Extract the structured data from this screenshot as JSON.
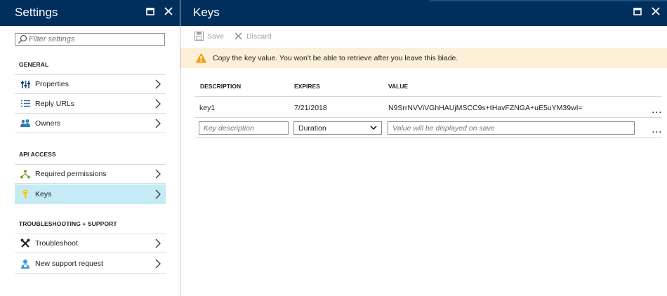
{
  "settings": {
    "title": "Settings",
    "filter_placeholder": "Filter settings",
    "sections": [
      {
        "title": "GENERAL",
        "items": [
          {
            "label": "Properties",
            "icon": "properties-icon"
          },
          {
            "label": "Reply URLs",
            "icon": "list-icon"
          },
          {
            "label": "Owners",
            "icon": "owners-icon"
          }
        ]
      },
      {
        "title": "API ACCESS",
        "items": [
          {
            "label": "Required permissions",
            "icon": "permissions-icon"
          },
          {
            "label": "Keys",
            "icon": "key-icon",
            "selected": true
          }
        ]
      },
      {
        "title": "TROUBLESHOOTING + SUPPORT",
        "items": [
          {
            "label": "Troubleshoot",
            "icon": "troubleshoot-icon"
          },
          {
            "label": "New support request",
            "icon": "support-icon"
          }
        ]
      }
    ]
  },
  "keys": {
    "title": "Keys",
    "toolbar": {
      "save_label": "Save",
      "discard_label": "Discard"
    },
    "warning": "Copy the key value. You won't be able to retrieve after you leave this blade.",
    "columns": {
      "description": "DESCRIPTION",
      "expires": "EXPIRES",
      "value": "VALUE"
    },
    "rows": [
      {
        "description": "key1",
        "expires": "7/21/2018",
        "value": "N9SrrNVViVGhHAUjMSCC9s+tHavFZNGA+uE5uYM39wI="
      }
    ],
    "new_row": {
      "description_placeholder": "Key description",
      "duration_value": "Duration",
      "value_placeholder": "Value will be displayed on save"
    },
    "more_label": "..."
  },
  "colors": {
    "header": "#002e5d",
    "selected": "#c5ebf7",
    "warning_bg": "#fcf0d8",
    "warning_icon": "#f39c12"
  }
}
